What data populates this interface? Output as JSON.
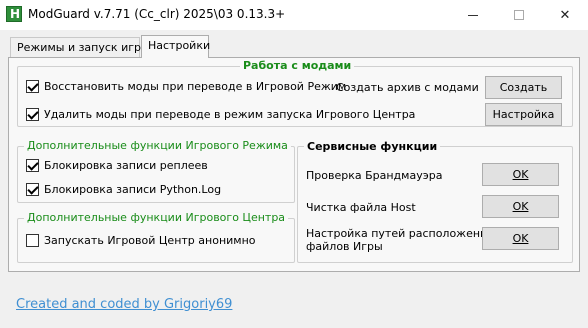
{
  "window": {
    "title": "ModGuard v.7.71 (Cc_clr) 2025\\03 0.13.3+",
    "minimize": "—",
    "maximize": "",
    "close": "✕"
  },
  "tabs": [
    {
      "label": "Режимы и запуск игры",
      "active": false
    },
    {
      "label": "Настройки",
      "active": true
    }
  ],
  "mods_group": {
    "title": "Работа с модами",
    "restore_checkbox": {
      "label": "Восстановить моды при переводе в Игровой Режим",
      "checked": true
    },
    "delete_checkbox": {
      "label": "Удалить моды при переводе в режим запуска Игрового Центра",
      "checked": true
    },
    "archive_label": "Создать архив с модами",
    "create_button": "Создать",
    "settings_button": "Настройка"
  },
  "game_mode_group": {
    "title": "Дополнительные функции Игрового Режима",
    "replay_checkbox": {
      "label": "Блокировка записи реплеев",
      "checked": true
    },
    "pythonlog_checkbox": {
      "label": "Блокировка записи Python.Log",
      "checked": true
    }
  },
  "game_center_group": {
    "title": "Дополнительные функции Игрового Центра",
    "anon_checkbox": {
      "label": "Запускать Игровой Центр анонимно",
      "checked": false
    }
  },
  "service_group": {
    "title": "Сервисные функции",
    "firewall_label": "Проверка Брандмауэра",
    "host_label": "Чистка файла Host",
    "paths_label_line1": "Настройка путей расположения",
    "paths_label_line2": "файлов Игры",
    "ok_label": "OK"
  },
  "footer": {
    "credit": "Created and coded by Grigoriy69"
  },
  "colors": {
    "green_heading": "#198c19",
    "link": "#3f8fd2"
  }
}
